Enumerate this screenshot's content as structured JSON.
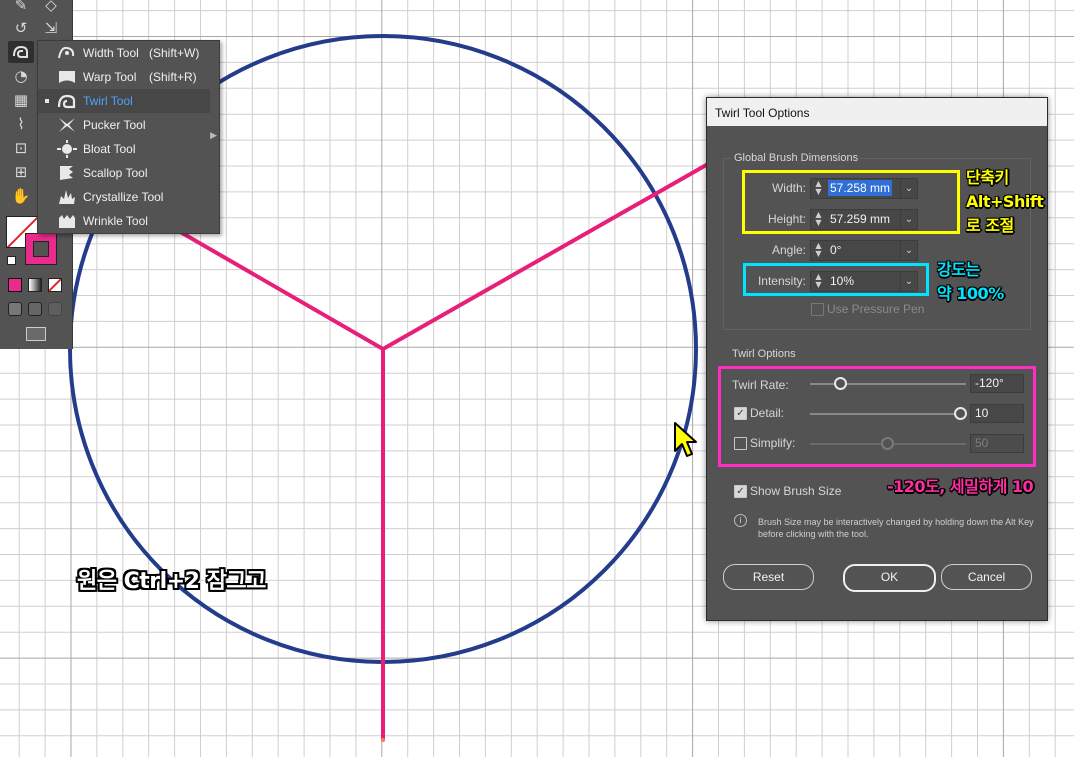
{
  "flyout": {
    "items": [
      {
        "label": "Width Tool",
        "shortcut": "(Shift+W)",
        "icon": "width-tool-icon"
      },
      {
        "label": "Warp Tool",
        "shortcut": "(Shift+R)",
        "icon": "warp-tool-icon"
      },
      {
        "label": "Twirl Tool",
        "shortcut": "",
        "icon": "twirl-tool-icon",
        "selected": true
      },
      {
        "label": "Pucker Tool",
        "shortcut": "",
        "icon": "pucker-tool-icon"
      },
      {
        "label": "Bloat Tool",
        "shortcut": "",
        "icon": "bloat-tool-icon"
      },
      {
        "label": "Scallop Tool",
        "shortcut": "",
        "icon": "scallop-tool-icon"
      },
      {
        "label": "Crystallize Tool",
        "shortcut": "",
        "icon": "crystallize-tool-icon"
      },
      {
        "label": "Wrinkle Tool",
        "shortcut": "",
        "icon": "wrinkle-tool-icon"
      }
    ]
  },
  "dialog": {
    "title": "Twirl Tool Options",
    "global": {
      "title": "Global Brush Dimensions",
      "width_label": "Width:",
      "width_value": "57.258 mm",
      "height_label": "Height:",
      "height_value": "57.259 mm",
      "angle_label": "Angle:",
      "angle_value": "0°",
      "intensity_label": "Intensity:",
      "intensity_value": "10%",
      "pressure_label": "Use Pressure Pen"
    },
    "twirl": {
      "title": "Twirl Options",
      "rate_label": "Twirl Rate:",
      "rate_value": "-120°",
      "detail_label": "Detail:",
      "detail_value": "10",
      "simplify_label": "Simplify:",
      "simplify_value": "50"
    },
    "show_brush_label": "Show Brush Size",
    "info": "Brush Size may be interactively changed by holding down the Alt Key before clicking with the tool.",
    "buttons": {
      "reset": "Reset",
      "ok": "OK",
      "cancel": "Cancel"
    }
  },
  "annotations": {
    "shortcut_line1": "단축키",
    "shortcut_line2": "Alt+Shift",
    "shortcut_line3": "로 조절",
    "intensity_line1": "강도는",
    "intensity_line2": "약 100%",
    "twirl_note": "-120도, 세밀하게 10",
    "circle_note": "원은 Ctrl+2 잠그고"
  },
  "colors": {
    "circle": "#1f3a8a",
    "lines": "#e81f7a",
    "highlight_yellow": "#ffff00",
    "highlight_cyan": "#00e5ff",
    "highlight_magenta": "#ff2dc4",
    "accent_blue": "#4da3ff"
  }
}
